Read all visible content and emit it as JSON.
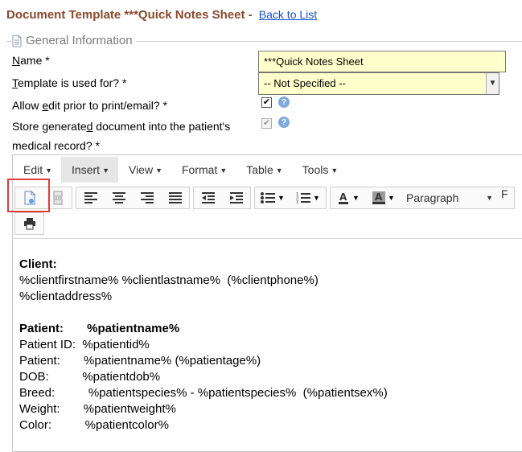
{
  "header": {
    "title": "Document Template ***Quick Notes Sheet - ",
    "back_link": "Back to List"
  },
  "section": {
    "legend": "General Information"
  },
  "form": {
    "name_label_u": "N",
    "name_label_rest": "ame *",
    "name_value": "***Quick Notes Sheet",
    "template_label_u": "T",
    "template_label_rest": "emplate is used for? *",
    "template_value": "-- Not Specified --",
    "allow_edit_pre": "Allow ",
    "allow_edit_u": "e",
    "allow_edit_rest": "dit prior to print/email? *",
    "store_pre": "Store generate",
    "store_u": "d",
    "store_rest": " document into the patient's",
    "store_line2": "medical record? *",
    "allow_edit_checked": true,
    "store_checked": true
  },
  "editor": {
    "menus": [
      "Edit",
      "Insert",
      "View",
      "Format",
      "Table",
      "Tools"
    ],
    "paragraph_label": "Paragraph",
    "format_label": "F",
    "content": {
      "client_heading": "Client:",
      "client_line1": "%clientfirstname% %clientlastname%  (%clientphone%)",
      "client_line2": "%clientaddress%",
      "patient_heading": "Patient:       %patientname%",
      "lines": [
        "Patient ID:  %patientid%",
        "Patient:       %patientname% (%patientage%)",
        "DOB:          %patientdob%",
        "Breed:          %patientspecies% - %patientspecies%  (%patientsex%)",
        "Weight:       %patientweight%",
        "Color:          %patientcolor%"
      ]
    }
  }
}
